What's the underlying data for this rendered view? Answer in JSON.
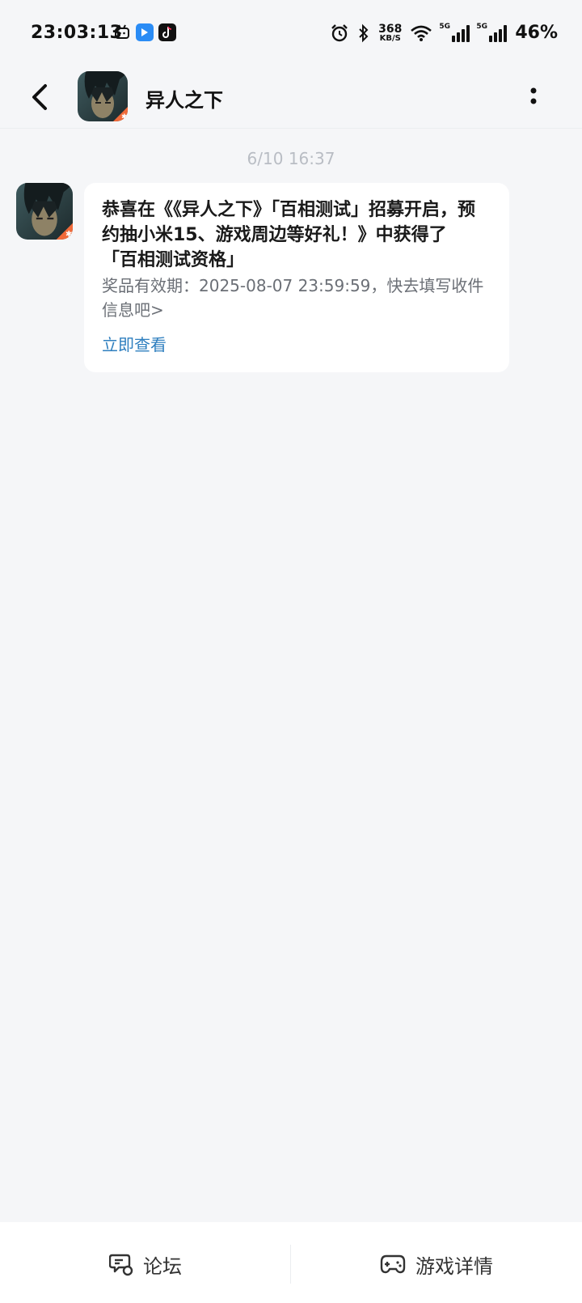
{
  "status_bar": {
    "time": "23:03:13",
    "net_speed_value": "368",
    "net_speed_unit": "KB/S",
    "signal1_label": "5G",
    "signal2_label": "5G",
    "battery": "46%",
    "icons": [
      "bilibili-icon",
      "app-blue-icon",
      "tiktok-icon",
      "alarm-icon",
      "bluetooth-icon",
      "wifi-icon",
      "signal-icon",
      "signal-icon"
    ]
  },
  "header": {
    "title": "异人之下",
    "avatar_icon": "game-avatar"
  },
  "chat": {
    "timestamp": "6/10  16:37",
    "message": {
      "title": "恭喜在《《异人之下》「百相测试」招募开启，预约抽小米15、游戏周边等好礼！》中获得了「百相测试资格」",
      "description": "奖品有效期：2025-08-07 23:59:59，快去填写收件信息吧>",
      "link": "立即查看"
    }
  },
  "bottom_bar": {
    "tabs": [
      {
        "label": "论坛",
        "icon": "forum-icon"
      },
      {
        "label": "游戏详情",
        "icon": "gamepad-icon"
      }
    ]
  },
  "colors": {
    "background": "#f5f6f8",
    "link": "#2f7fbf",
    "bubble": "#ffffff"
  }
}
